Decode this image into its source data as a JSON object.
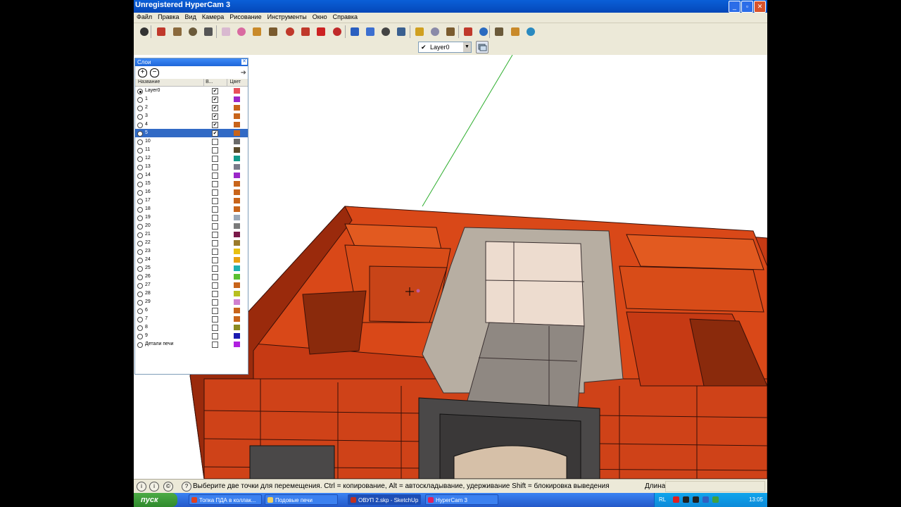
{
  "window": {
    "title": "Unregistered HyperCam 3",
    "buttons": [
      "_",
      "▫",
      "✕"
    ]
  },
  "menu": [
    "Файл",
    "Правка",
    "Вид",
    "Камера",
    "Рисование",
    "Инструменты",
    "Окно",
    "Справка"
  ],
  "toolbar": {
    "tools": [
      {
        "name": "select-tool-icon",
        "color": "#333333"
      },
      {
        "name": "line-tool-icon",
        "color": "#c0392b"
      },
      {
        "name": "rectangle-tool-icon",
        "color": "#8b6a3d"
      },
      {
        "name": "circle-tool-icon",
        "color": "#6b5a3a"
      },
      {
        "name": "arc-tool-icon",
        "color": "#555555"
      },
      {
        "name": "make-component-icon",
        "color": "#d9b9d0"
      },
      {
        "name": "eraser-tool-icon",
        "color": "#d96aa0"
      },
      {
        "name": "paint-bucket-icon",
        "color": "#c98a2a"
      },
      {
        "name": "push-pull-icon",
        "color": "#7a5b2e"
      },
      {
        "name": "offset-icon",
        "color": "#c0392b"
      },
      {
        "name": "move-tool-icon",
        "color": "#c0392b"
      },
      {
        "name": "rotate-tool-icon",
        "color": "#cc2222"
      },
      {
        "name": "follow-me-icon",
        "color": "#c02a2a"
      },
      {
        "name": "orbit-tool-icon",
        "color": "#2a5fc0"
      },
      {
        "name": "pan-tool-icon",
        "color": "#3c6fd0"
      },
      {
        "name": "zoom-tool-icon",
        "color": "#444444"
      },
      {
        "name": "zoom-extents-icon",
        "color": "#3a6090"
      },
      {
        "name": "tape-measure-icon",
        "color": "#d0a020"
      },
      {
        "name": "protractor-icon",
        "color": "#8a8aa8"
      },
      {
        "name": "section-plane-icon",
        "color": "#7a5b2e"
      },
      {
        "name": "get-models-icon",
        "color": "#c0392b"
      },
      {
        "name": "share-model-icon",
        "color": "#2a6bc0"
      },
      {
        "name": "components-icon",
        "color": "#6b5a3a"
      },
      {
        "name": "materials-icon",
        "color": "#c98a2a"
      },
      {
        "name": "styles-icon",
        "color": "#2a8ac0"
      }
    ],
    "layer_select": "Layer0",
    "layer_check": "✔",
    "layer_dropdown": "▼"
  },
  "layers_panel": {
    "title": "Слои",
    "close": "✕",
    "add": "+",
    "remove": "−",
    "export": "➜",
    "col_name": "Название",
    "col_visible": "В...",
    "col_color": "Цвет",
    "rows": [
      {
        "name": "Layer0",
        "visible": true,
        "color": "#e8505a",
        "active": true
      },
      {
        "name": "1",
        "visible": true,
        "color": "#9b27c9"
      },
      {
        "name": "2",
        "visible": true,
        "color": "#c8641a"
      },
      {
        "name": "3",
        "visible": true,
        "color": "#c8641a"
      },
      {
        "name": "4",
        "visible": true,
        "color": "#c8641a"
      },
      {
        "name": "5",
        "visible": true,
        "color": "#c8641a",
        "selected": true
      },
      {
        "name": "10",
        "visible": false,
        "color": "#6a6a6a"
      },
      {
        "name": "11",
        "visible": false,
        "color": "#5a4a2a"
      },
      {
        "name": "12",
        "visible": false,
        "color": "#139a8a"
      },
      {
        "name": "13",
        "visible": false,
        "color": "#7a7a8a"
      },
      {
        "name": "14",
        "visible": false,
        "color": "#9b27c9"
      },
      {
        "name": "15",
        "visible": false,
        "color": "#c8641a"
      },
      {
        "name": "16",
        "visible": false,
        "color": "#c8641a"
      },
      {
        "name": "17",
        "visible": false,
        "color": "#c8641a"
      },
      {
        "name": "18",
        "visible": false,
        "color": "#c8641a"
      },
      {
        "name": "19",
        "visible": false,
        "color": "#9aa8b8"
      },
      {
        "name": "20",
        "visible": false,
        "color": "#7a7a7a"
      },
      {
        "name": "21",
        "visible": false,
        "color": "#7a1a4a"
      },
      {
        "name": "22",
        "visible": false,
        "color": "#9a7a2a"
      },
      {
        "name": "23",
        "visible": false,
        "color": "#e8c010"
      },
      {
        "name": "24",
        "visible": false,
        "color": "#e8a010"
      },
      {
        "name": "25",
        "visible": false,
        "color": "#20b0b0"
      },
      {
        "name": "26",
        "visible": false,
        "color": "#5ac030"
      },
      {
        "name": "27",
        "visible": false,
        "color": "#c8641a"
      },
      {
        "name": "28",
        "visible": false,
        "color": "#b8c020"
      },
      {
        "name": "29",
        "visible": false,
        "color": "#d080d0"
      },
      {
        "name": "6",
        "visible": false,
        "color": "#c8641a"
      },
      {
        "name": "7",
        "visible": false,
        "color": "#c8641a"
      },
      {
        "name": "8",
        "visible": false,
        "color": "#8a8a20"
      },
      {
        "name": "9",
        "visible": false,
        "color": "#1a1ab0"
      },
      {
        "name": "Детали печи",
        "visible": false,
        "color": "#b020e0"
      }
    ]
  },
  "statusbar": {
    "text": "Выберите две точки для перемещения.  Ctrl = копирование, Alt = автоскладывание, удерживание Shift = блокировка выведения",
    "measure_label": "Длина",
    "icons": [
      "i",
      "i",
      "©",
      "?"
    ]
  },
  "taskbar": {
    "start": "пуск",
    "tasks": [
      {
        "label": "Топка ПДА в коллак...",
        "color": "#e04020"
      },
      {
        "label": "Подовые печи",
        "color": "#f0d060"
      },
      {
        "label": "ОВУП 2.skp - SketchUp",
        "color": "#c03020",
        "active": true
      },
      {
        "label": "HyperCam 3",
        "color": "#e02060"
      }
    ],
    "lang": "RL",
    "clock": "13:05"
  }
}
